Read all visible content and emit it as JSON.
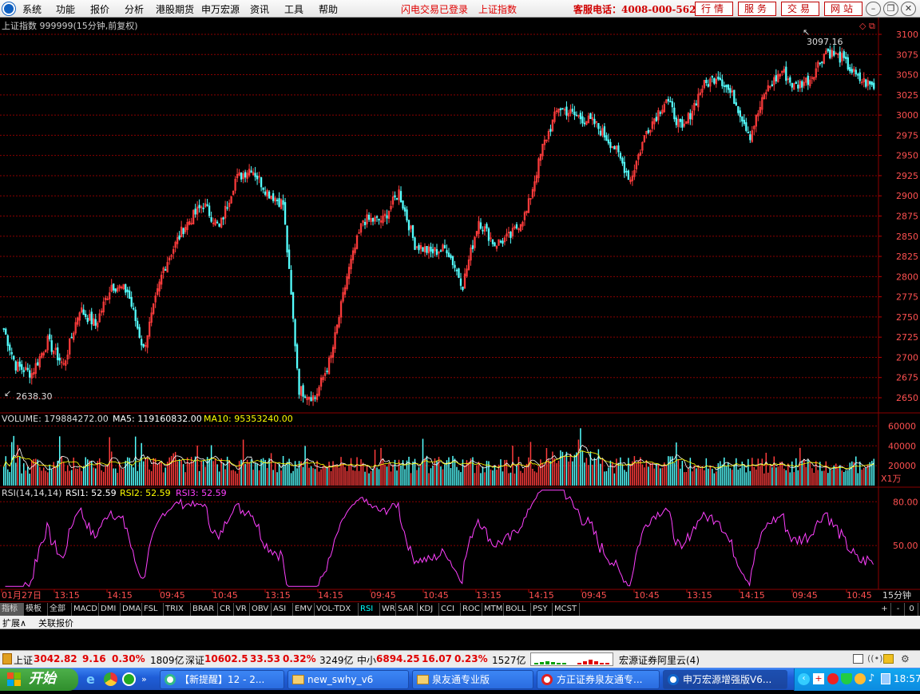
{
  "menu": {
    "items": [
      "系统",
      "功能",
      "报价",
      "分析",
      "港股期货",
      "申万宏源",
      "资讯",
      "工具",
      "帮助"
    ],
    "flash_login": "闪电交易已登录",
    "index_name_link": "上证指数",
    "service_hotline": "客服电话：4008-000-562",
    "buttons": [
      "行情",
      "服务",
      "交易",
      "网站"
    ]
  },
  "chart": {
    "title": "上证指数 999999(15分钟,前复权)",
    "high_label": "3097.16",
    "low_label": "2638.30",
    "y_ticks": [
      "3100",
      "3075",
      "3050",
      "3025",
      "3000",
      "2975",
      "2950",
      "2925",
      "2900",
      "2875",
      "2850",
      "2825",
      "2800",
      "2775",
      "2750",
      "2725",
      "2700",
      "2675",
      "2650"
    ],
    "volume": {
      "label": "VOLUME: 179884272.00",
      "ma5": "MA5: 119160832.00",
      "ma10": "MA10: 95353240.00",
      "y_ticks": [
        "60000",
        "40000",
        "20000"
      ],
      "unit": "X1万"
    },
    "rsi": {
      "label": "RSI(14,14,14)",
      "rsi1": "RSI1: 52.59",
      "rsi2": "RSI2: 52.59",
      "rsi3": "RSI3: 52.59",
      "y_ticks": [
        "80.00",
        "50.00"
      ]
    },
    "time_labels": [
      "01月27日",
      "13:15",
      "14:15",
      "09:45",
      "10:45",
      "13:15",
      "14:15",
      "09:45",
      "10:45",
      "13:15",
      "14:15",
      "09:45",
      "10:45",
      "13:15",
      "14:15",
      "09:45",
      "10:45"
    ],
    "period": "15分钟",
    "colors": {
      "up": "#ff3c3c",
      "down": "#54ffff",
      "grid": "#8b0000",
      "rsi": "#ff40ff",
      "ma5": "#ffffff",
      "ma10": "#ffff00"
    }
  },
  "chart_data": {
    "type": "candlestick",
    "title": "上证指数 999999(15分钟,前复权)",
    "ylim": [
      2638.3,
      3097.16
    ],
    "waypoints": [
      [
        0,
        2735
      ],
      [
        6,
        2690
      ],
      [
        14,
        2680
      ],
      [
        22,
        2720
      ],
      [
        30,
        2690
      ],
      [
        38,
        2760
      ],
      [
        46,
        2740
      ],
      [
        54,
        2790
      ],
      [
        62,
        2782
      ],
      [
        70,
        2710
      ],
      [
        80,
        2810
      ],
      [
        90,
        2860
      ],
      [
        100,
        2890
      ],
      [
        108,
        2860
      ],
      [
        116,
        2920
      ],
      [
        124,
        2935
      ],
      [
        132,
        2905
      ],
      [
        140,
        2890
      ],
      [
        148,
        2660
      ],
      [
        156,
        2650
      ],
      [
        164,
        2700
      ],
      [
        172,
        2800
      ],
      [
        180,
        2870
      ],
      [
        190,
        2870
      ],
      [
        198,
        2905
      ],
      [
        206,
        2840
      ],
      [
        214,
        2830
      ],
      [
        222,
        2835
      ],
      [
        230,
        2790
      ],
      [
        238,
        2870
      ],
      [
        246,
        2840
      ],
      [
        254,
        2850
      ],
      [
        262,
        2880
      ],
      [
        270,
        2960
      ],
      [
        278,
        3010
      ],
      [
        286,
        3000
      ],
      [
        296,
        2990
      ],
      [
        306,
        2960
      ],
      [
        314,
        2920
      ],
      [
        322,
        2980
      ],
      [
        332,
        3020
      ],
      [
        340,
        2980
      ],
      [
        350,
        3035
      ],
      [
        358,
        3050
      ],
      [
        366,
        3020
      ],
      [
        374,
        2975
      ],
      [
        382,
        3030
      ],
      [
        390,
        3055
      ],
      [
        396,
        3035
      ],
      [
        404,
        3045
      ],
      [
        412,
        3080
      ],
      [
        420,
        3070
      ],
      [
        428,
        3045
      ],
      [
        436,
        3035
      ]
    ],
    "volume_unit": "X1万",
    "volume_ylim": [
      0,
      70000
    ],
    "rsi_ylim": [
      20,
      90
    ],
    "rsi_last": 52.59
  },
  "indicator_tabs": [
    "指标",
    "模板",
    "全部",
    "MACD",
    "DMI",
    "DMA",
    "FSL",
    "TRIX",
    "BRAR",
    "CR",
    "VR",
    "OBV",
    "ASI",
    "EMV",
    "VOL-TDX",
    "RSI",
    "WR",
    "SAR",
    "KDJ",
    "CCI",
    "ROC",
    "MTM",
    "BOLL",
    "PSY",
    "MCST"
  ],
  "active_tab": "RSI",
  "tab_right": [
    "+",
    "-",
    "0"
  ],
  "sub_tabs": [
    "扩展∧",
    "关联报价"
  ],
  "status": {
    "sh_label": "上证",
    "sh_value": "3042.82",
    "sh_change": "9.16",
    "sh_pct": "0.30%",
    "sh_amount": "1809亿",
    "sz_label": "深证",
    "sz_value": "10602.5",
    "sz_change": "33.53",
    "sz_pct": "0.32%",
    "sz_amount": "3249亿",
    "zx_label": "中小",
    "zx_value": "6894.25",
    "zx_change": "16.07",
    "zx_pct": "0.23%",
    "zx_amount": "1527亿",
    "broker": "宏源证券阿里云(4)"
  },
  "taskbar": {
    "start": "开始",
    "tasks": [
      "【新提醒】12 - 2...",
      "new_swhy_v6",
      "泉友通专业版",
      "方正证券泉友通专...",
      "申万宏源增强版V6..."
    ],
    "clock": "18:57"
  }
}
